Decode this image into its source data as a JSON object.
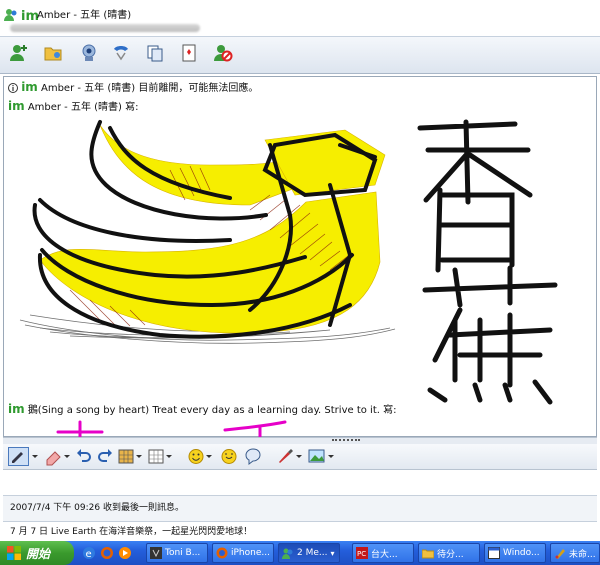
{
  "window": {
    "title_logo": "im",
    "title": "Amber - 五年 (晴書)"
  },
  "toolbar": {
    "buttons": [
      "add-contact-icon",
      "share-files-icon",
      "video-call-icon",
      "voice-call-icon",
      "activities-icon",
      "games-icon",
      "block-icon"
    ]
  },
  "chat": {
    "notice_logo": "im",
    "notice": "Amber - 五年 (晴書) 目前離開，可能無法回應。",
    "sender1": "Amber - 五年 (晴書) 寫:",
    "handwriting_chars": [
      "香",
      "蕉"
    ],
    "sender2": "鵝(Sing a song by heart) Treat every day as a learning day. Strive to it. 寫:"
  },
  "status": {
    "last_message": "2007/7/4 下午 09:26 收到最後一則訊息。",
    "ad": "7 月 7 日 Live Earth 在海洋音樂祭，一起星光閃閃愛地球！"
  },
  "taskbar": {
    "start": "開始",
    "tasks": [
      "Toni B...",
      "iPhone...",
      "2 Me...",
      "台大...",
      "待分...",
      "Windo...",
      "未命..."
    ]
  },
  "colors": {
    "im_green": "#2f9a2f",
    "taskbar_blue": "#245edb",
    "start_green": "#3a9a2d",
    "banana_yellow": "#f6ee00",
    "pen_magenta": "#e600c8"
  }
}
